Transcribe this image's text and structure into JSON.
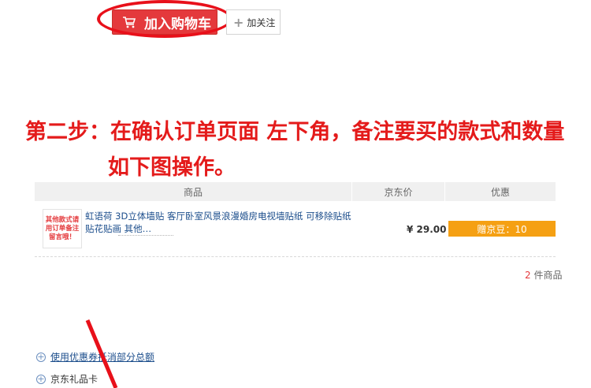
{
  "top_buttons": {
    "cart_label": "加入购物车",
    "follow_label": "加关注"
  },
  "instruction": {
    "line1": "第二步：在确认订单页面 左下角，备注要买的款式和数量",
    "line2": "如下图操作。"
  },
  "table": {
    "headers": [
      "商品",
      "京东价",
      "优惠"
    ],
    "item": {
      "thumb_text": "其他款式请用订单备注留言哦！",
      "name_line1": "虹语荷 3D立体墙贴 客厅卧室风景浪漫婚房电视墙贴纸 可移除贴纸",
      "name_line2": "贴花贴画 其他…",
      "price": "¥ 29.00",
      "promo": "赠京豆：10"
    },
    "count_num": "2",
    "count_text": "件商品"
  },
  "bottom": {
    "coupon_label": "使用优惠券抵消部分总额",
    "giftcard_label": "京东礼品卡"
  },
  "colors": {
    "brand_red": "#e4393c",
    "annotation_red": "#e41b1b",
    "promo_orange": "#f5a013",
    "link_blue": "#1c4e8c"
  },
  "icons": [
    "cart-icon",
    "plus-icon",
    "expand-circle-icon"
  ]
}
